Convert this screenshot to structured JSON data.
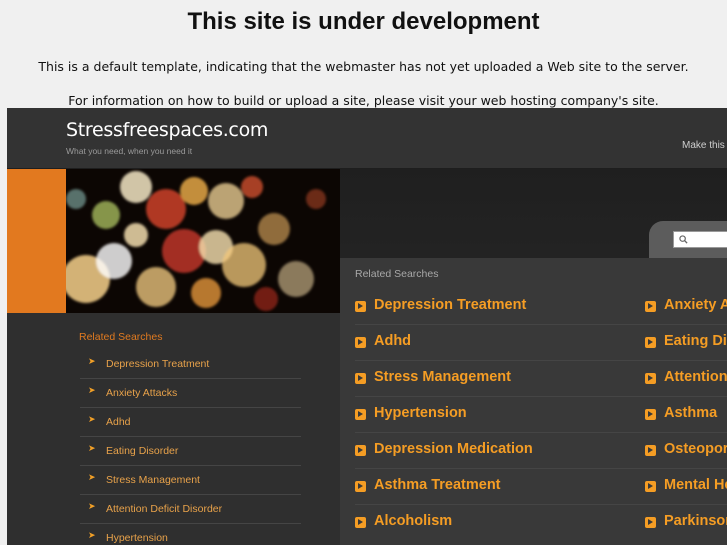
{
  "notice": {
    "title": "This site is under development",
    "line1": "This is a default template, indicating that the webmaster has not yet uploaded a Web site to the server.",
    "line2": "For information on how to build or upload a site, please visit your web hosting company's site."
  },
  "site": {
    "title": "Stressfreespaces.com",
    "tagline": "What you need, when you need it",
    "make_link": "Make this"
  },
  "search": {
    "placeholder": ""
  },
  "sidebar": {
    "heading": "Related Searches",
    "items": [
      "Depression Treatment",
      "Anxiety Attacks",
      "Adhd",
      "Eating Disorder",
      "Stress Management",
      "Attention Deficit Disorder",
      "Hypertension"
    ]
  },
  "main": {
    "heading": "Related Searches",
    "left_items": [
      "Depression Treatment",
      "Adhd",
      "Stress Management",
      "Hypertension",
      "Depression Medication",
      "Asthma Treatment",
      "Alcoholism"
    ],
    "right_items": [
      "Anxiety A",
      "Eating Di",
      "Attention",
      "Asthma",
      "Osteopor",
      "Mental He",
      "Parkinson"
    ]
  },
  "colors": {
    "accent": "#e2791f",
    "link": "#f59d24",
    "background": "#2b2b2b"
  }
}
